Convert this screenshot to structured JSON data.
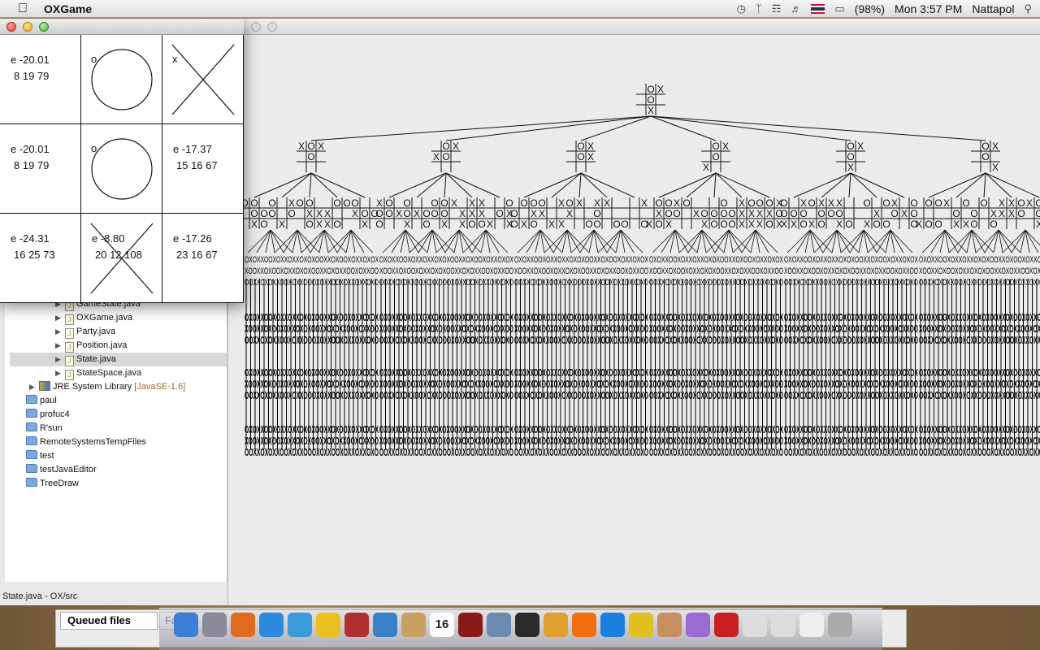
{
  "menubar": {
    "app_name": "OXGame",
    "icons": [
      "apple-icon",
      "time-machine-icon",
      "bluetooth-icon",
      "wifi-icon",
      "volume-icon",
      "flag-icon",
      "battery-icon",
      "spotlight-icon"
    ],
    "battery": "(98%)",
    "clock": "Mon 3:57 PM",
    "user": "Nattapol"
  },
  "ox_window": {
    "cells": [
      {
        "mark": "",
        "shape": "",
        "eval": "e -20.01",
        "nums": "8 19 79"
      },
      {
        "mark": "o",
        "shape": "circle",
        "eval": "",
        "nums": ""
      },
      {
        "mark": "x",
        "shape": "cross",
        "eval": "",
        "nums": ""
      },
      {
        "mark": "",
        "shape": "",
        "eval": "e -20.01",
        "nums": "8 19 79"
      },
      {
        "mark": "o",
        "shape": "circle",
        "eval": "",
        "nums": ""
      },
      {
        "mark": "",
        "shape": "",
        "eval": "e -17.37",
        "nums": "15 16 67"
      },
      {
        "mark": "",
        "shape": "",
        "eval": "e -24.31",
        "nums": "16 25 73"
      },
      {
        "mark": "",
        "shape": "cross",
        "eval": "e -8.80",
        "nums": "20 12 108"
      },
      {
        "mark": "",
        "shape": "",
        "eval": "e -17.26",
        "nums": "23 16 67"
      }
    ]
  },
  "explorer": {
    "files": [
      {
        "label": "GameState.java",
        "type": "java"
      },
      {
        "label": "OXGame.java",
        "type": "java"
      },
      {
        "label": "Party.java",
        "type": "java"
      },
      {
        "label": "Position.java",
        "type": "java"
      },
      {
        "label": "State.java",
        "type": "java",
        "selected": true
      },
      {
        "label": "StateSpace.java",
        "type": "java"
      }
    ],
    "library": {
      "label": "JRE System Library",
      "extra": "[JavaSE-1.6]"
    },
    "projects": [
      "paul",
      "profuc4",
      "R'sun",
      "RemoteSystemsTempFiles",
      "test",
      "testJavaEditor",
      "TreeDraw"
    ],
    "status": "State.java - OX/src"
  },
  "tree": {
    "root_board": [
      "",
      "O",
      "X",
      "",
      "O",
      "",
      "",
      "X",
      ""
    ],
    "level1_boards": [
      [
        "X",
        "O",
        "X",
        "",
        "O",
        "",
        "",
        "",
        ""
      ],
      [
        "",
        "O",
        "X",
        "X",
        "O",
        "",
        "",
        "",
        ""
      ],
      [
        "",
        "O",
        "X",
        "",
        "O",
        "X",
        "",
        "",
        ""
      ],
      [
        "",
        "O",
        "X",
        "",
        "O",
        "",
        "X",
        "",
        ""
      ],
      [
        "",
        "O",
        "X",
        "",
        "O",
        "",
        "",
        "X",
        ""
      ],
      [
        "",
        "O",
        "X",
        "",
        "O",
        "",
        "",
        "",
        "X"
      ]
    ]
  },
  "taskbar": {
    "queued_label": "Queued files",
    "failed_label": "Fa",
    "dock_icons": [
      "finder-icon",
      "launchpad-icon",
      "firefox-icon",
      "app-store-icon",
      "safari-icon",
      "chrome-icon",
      "dictionary-icon",
      "mail-icon",
      "contacts-icon",
      "calendar-icon",
      "photo-booth-icon",
      "iphoto-icon",
      "imovie-icon",
      "cocktail-icon",
      "vlc-icon",
      "itunes-icon",
      "radiation-icon",
      "archive-icon",
      "sphere-icon",
      "filezilla-icon",
      "coffee-icon",
      "coffee2-icon",
      "document-icon",
      "trash-icon"
    ],
    "calendar_day": "16"
  }
}
